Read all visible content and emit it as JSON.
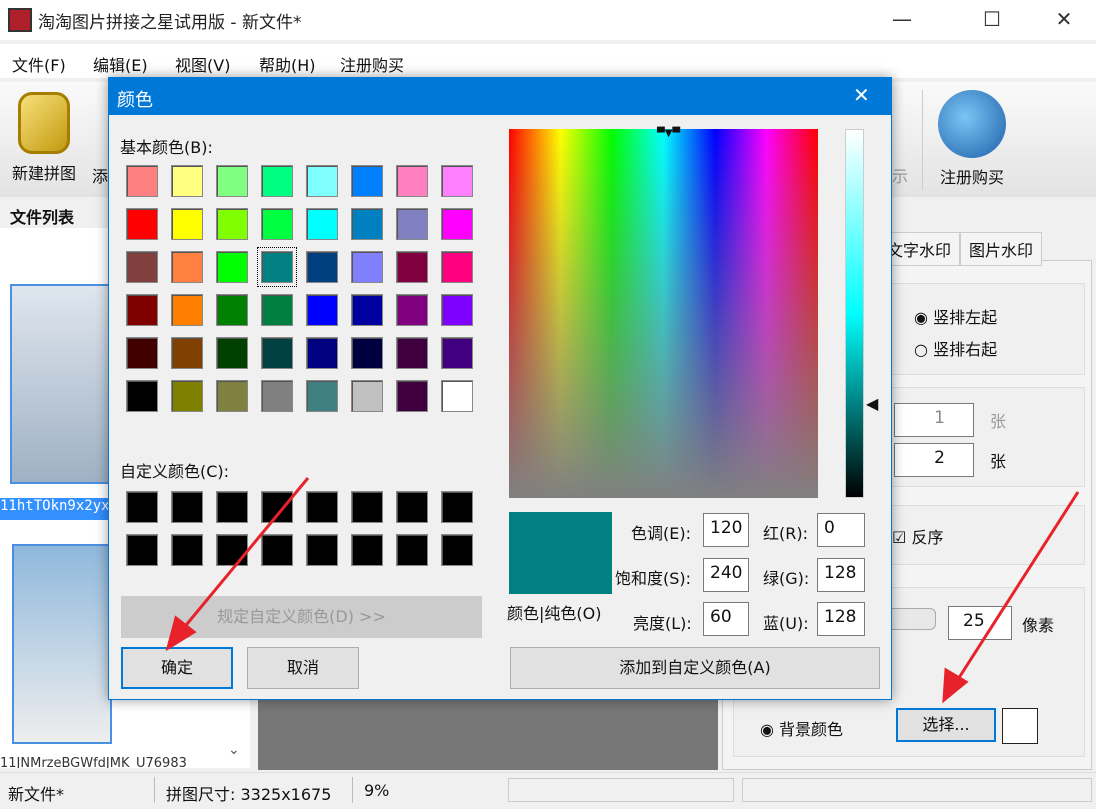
{
  "window": {
    "title": "淘淘图片拼接之星试用版 - 新文件*",
    "minimize": "—",
    "maximize": "☐",
    "close": "✕"
  },
  "menu": [
    "文件(F)",
    "编辑(E)",
    "视图(V)",
    "帮助(H)",
    "注册购买"
  ],
  "toolbar": {
    "new": "新建拼图",
    "add": "添",
    "show": "示",
    "register": "注册购买"
  },
  "filelist": {
    "title": "文件列表",
    "items": [
      "11htTOkn9x2yx",
      "11JNMrzeBGWfdJMK_U76983"
    ]
  },
  "right": {
    "tabs": [
      "文字水印",
      "图片水印"
    ],
    "radio_left": "竖排左起",
    "radio_right": "竖排右起",
    "spin1": "1",
    "unit1": "张",
    "spin2": "2",
    "unit2": "张",
    "reverse": "反序",
    "spacing": "25",
    "pixel": "像素",
    "bg_color": "背景颜色",
    "choose": "选择..."
  },
  "status": {
    "file": "新文件*",
    "size": "拼图尺寸: 3325x1675",
    "zoom": "9%"
  },
  "dialog": {
    "title": "颜色",
    "close": "✕",
    "basic_label": "基本颜色(B):",
    "custom_label": "自定义颜色(C):",
    "define_custom": "规定自定义颜色(D) >>",
    "ok": "确定",
    "cancel": "取消",
    "solid_label": "颜色|纯色(O)",
    "add_custom": "添加到自定义颜色(A)",
    "hue_label": "色调(E):",
    "hue": "120",
    "sat_label": "饱和度(S):",
    "sat": "240",
    "lum_label": "亮度(L):",
    "lum": "60",
    "red_label": "红(R):",
    "red": "0",
    "green_label": "绿(G):",
    "green": "128",
    "blue_label": "蓝(U):",
    "blue": "128",
    "selected_color": "#008080",
    "basic_colors": [
      "#FF8080",
      "#FFFF80",
      "#80FF80",
      "#00FF80",
      "#80FFFF",
      "#0080FF",
      "#FF80C0",
      "#FF80FF",
      "#FF0000",
      "#FFFF00",
      "#80FF00",
      "#00FF40",
      "#00FFFF",
      "#0080C0",
      "#8080C0",
      "#FF00FF",
      "#804040",
      "#FF8040",
      "#00FF00",
      "#008080",
      "#004080",
      "#8080FF",
      "#800040",
      "#FF0080",
      "#800000",
      "#FF8000",
      "#008000",
      "#008040",
      "#0000FF",
      "#0000A0",
      "#800080",
      "#8000FF",
      "#400000",
      "#804000",
      "#004000",
      "#004040",
      "#000080",
      "#000040",
      "#400040",
      "#400080",
      "#000000",
      "#808000",
      "#808040",
      "#808080",
      "#408080",
      "#C0C0C0",
      "#400040",
      "#FFFFFF"
    ],
    "selected_index": 19,
    "custom_colors": [
      "#000000",
      "#000000",
      "#000000",
      "#000000",
      "#000000",
      "#000000",
      "#000000",
      "#000000",
      "#000000",
      "#000000",
      "#000000",
      "#000000",
      "#000000",
      "#000000",
      "#000000",
      "#000000"
    ]
  }
}
